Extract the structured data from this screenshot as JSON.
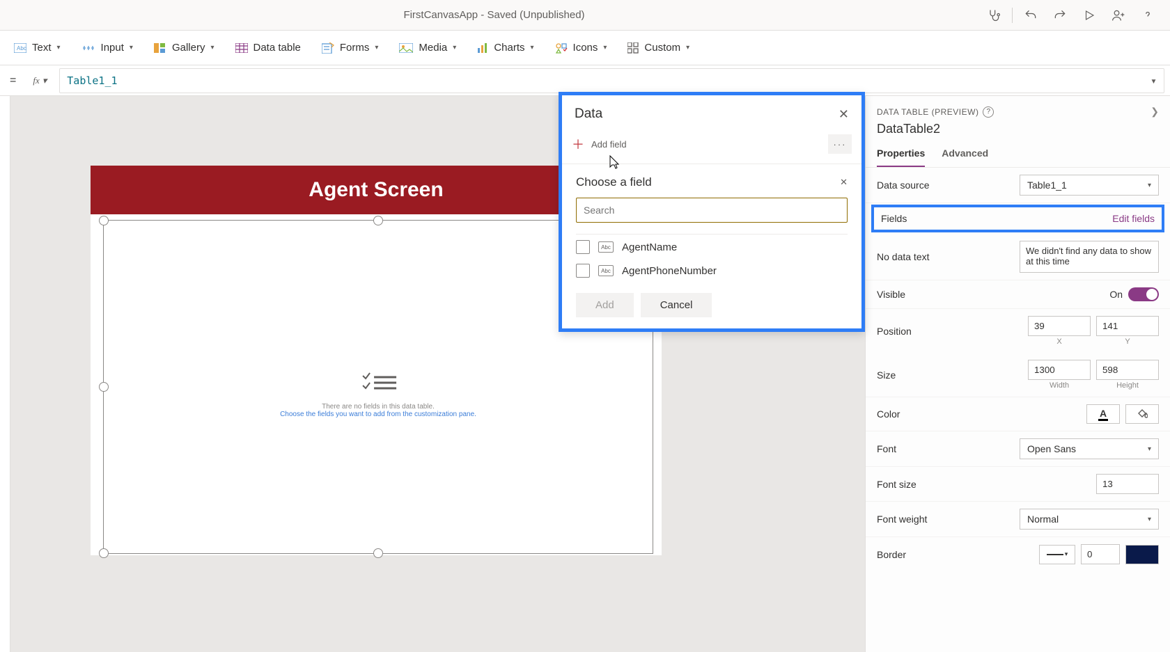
{
  "topbar": {
    "title": "FirstCanvasApp - Saved (Unpublished)"
  },
  "ribbon": {
    "text": "Text",
    "input": "Input",
    "gallery": "Gallery",
    "datatable": "Data table",
    "forms": "Forms",
    "media": "Media",
    "charts": "Charts",
    "icons": "Icons",
    "custom": "Custom"
  },
  "formula": {
    "value": "Table1_1"
  },
  "canvas": {
    "header": "Agent Screen",
    "empty_line1": "There are no fields in this data table.",
    "empty_line2": "Choose the fields you want to add from the customization pane."
  },
  "dataPanel": {
    "title": "Data",
    "addField": "Add field",
    "chooseTitle": "Choose a field",
    "searchPlaceholder": "Search",
    "fields": [
      {
        "name": "AgentName"
      },
      {
        "name": "AgentPhoneNumber"
      }
    ],
    "addBtn": "Add",
    "cancelBtn": "Cancel"
  },
  "props": {
    "category": "DATA TABLE (PREVIEW)",
    "name": "DataTable2",
    "tabs": {
      "properties": "Properties",
      "advanced": "Advanced"
    },
    "dataSourceLabel": "Data source",
    "dataSourceValue": "Table1_1",
    "fieldsLabel": "Fields",
    "editFields": "Edit fields",
    "noDataLabel": "No data text",
    "noDataValue": "We didn't find any data to show at this time",
    "visibleLabel": "Visible",
    "visibleOn": "On",
    "positionLabel": "Position",
    "posX": "39",
    "posY": "141",
    "xLabel": "X",
    "yLabel": "Y",
    "sizeLabel": "Size",
    "width": "1300",
    "height": "598",
    "widthLabel": "Width",
    "heightLabel": "Height",
    "colorLabel": "Color",
    "fontLabel": "Font",
    "fontValue": "Open Sans",
    "fontSizeLabel": "Font size",
    "fontSizeValue": "13",
    "fontWeightLabel": "Font weight",
    "fontWeightValue": "Normal",
    "borderLabel": "Border",
    "borderWidth": "0"
  }
}
